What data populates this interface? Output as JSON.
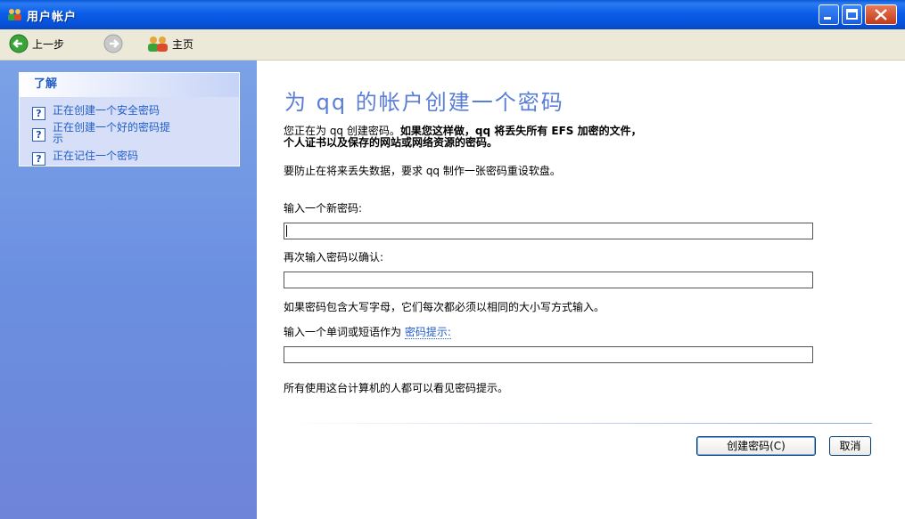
{
  "window": {
    "title": "用户帐户",
    "icon": "users-icon"
  },
  "toolbar": {
    "back_label": "上一步",
    "forward_icon": "forward-arrow-icon",
    "home_label": "主页"
  },
  "sidebar": {
    "learn_header": "了解",
    "items": [
      {
        "label": "正在创建一个安全密码"
      },
      {
        "label_line1": "正在创建一个好的密码提",
        "label_line2": "示"
      },
      {
        "label": "正在记住一个密码"
      }
    ]
  },
  "main": {
    "heading": "为 qq 的帐户创建一个密码",
    "warning_prefix": "您正在为 qq 创建密码。",
    "warning_bold_line1": "如果您这样做，qq 将丢失所有 EFS 加密的文件，",
    "warning_bold_line2": "个人证书以及保存的网站或网络资源的密码。",
    "reset_disk_note": "要防止在将来丢失数据，要求 qq 制作一张密码重设软盘。",
    "new_password_label": "输入一个新密码:",
    "new_password_value": "",
    "confirm_password_label": "再次输入密码以确认:",
    "confirm_password_value": "",
    "case_note": "如果密码包含大写字母，它们每次都必须以相同的大小写方式输入。",
    "hint_label_prefix": "输入一个单词或短语作为",
    "hint_link": "密码提示:",
    "hint_value": "",
    "hint_visibility_note": "所有使用这台计算机的人都可以看见密码提示。",
    "create_button": "创建密码(C)",
    "cancel_button": "取消"
  },
  "colors": {
    "titlebar": "#0b5ee8",
    "sidebar": "#6b8fe0",
    "heading": "#5a7ed6",
    "link": "#215dc6"
  }
}
